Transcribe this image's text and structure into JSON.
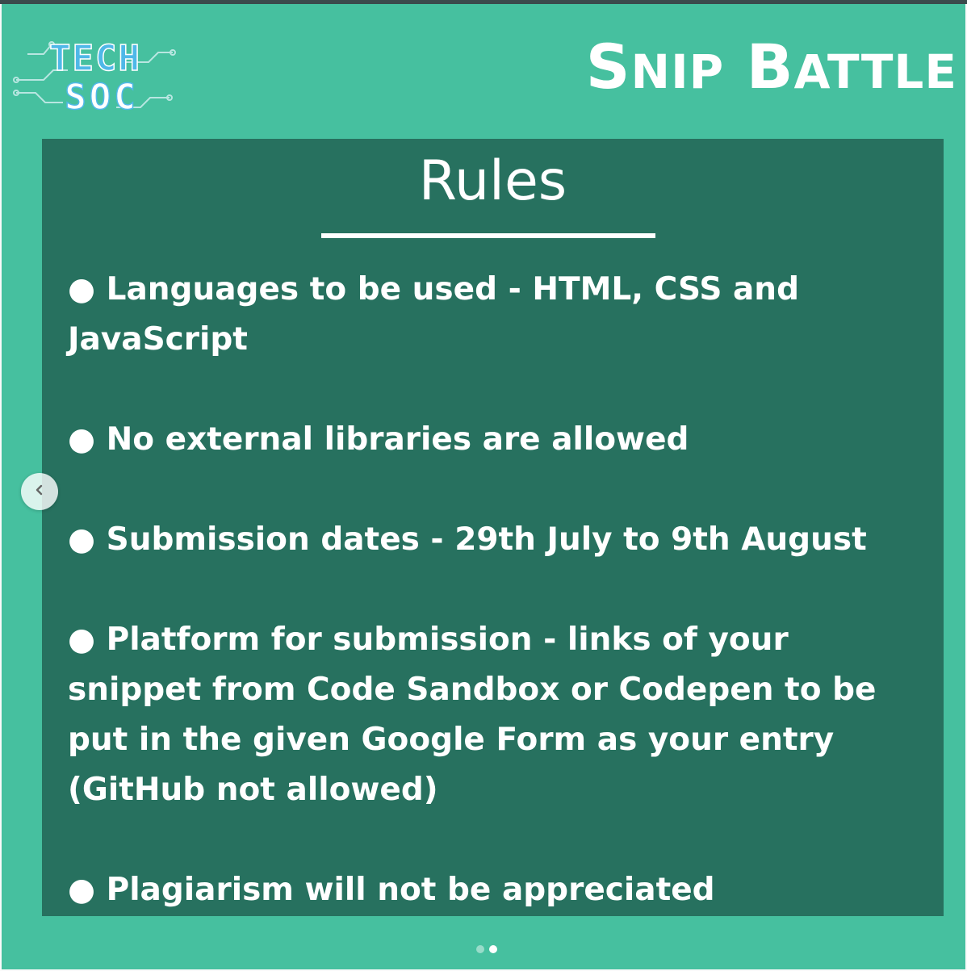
{
  "brand": {
    "title_first_big": "S",
    "title_first_rest": "NIP",
    "title_second_big": "B",
    "title_second_rest": "ATTLE",
    "logo_text_line1": "TECH",
    "logo_text_line2": "SOC"
  },
  "panel": {
    "heading": "Rules",
    "rules": [
      "● Languages to be used - HTML, CSS and JavaScript",
      "● No external libraries are allowed",
      "● Submission dates -  29th July to 9th August",
      "● Platform for submission -  links of your snippet from Code Sandbox or Codepen to be put in the given Google Form as your entry (GitHub not allowed)",
      "● Plagiarism will not be appreciated"
    ]
  },
  "carousel": {
    "prev_icon": "chevron-left-icon",
    "slide_count": 2,
    "active_slide": 2
  },
  "colors": {
    "background": "#46c09f",
    "panel": "#27715f",
    "text": "#ffffff",
    "logo_accent": "#4fb8e8"
  }
}
